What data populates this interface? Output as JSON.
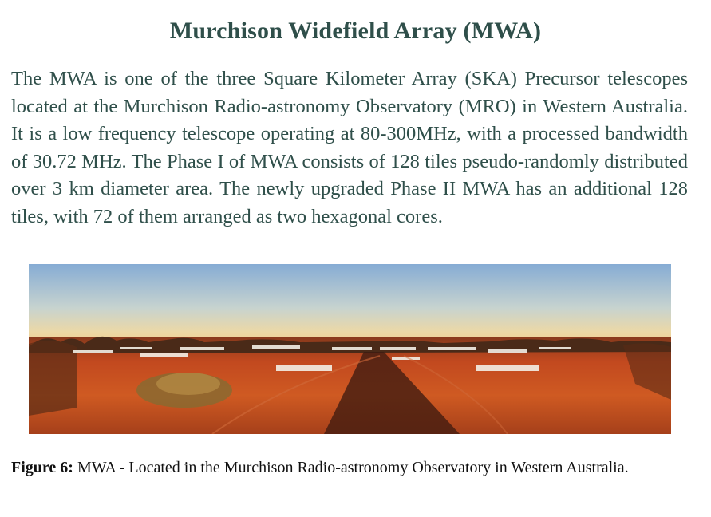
{
  "header": {
    "title": "Murchison Widefield Array (MWA)"
  },
  "main": {
    "paragraph": "The MWA is one of the three Square Kilometer Array (SKA) Precursor telescopes located at the Murchison Radio-astronomy Observatory (MRO) in Western Australia. It is a low frequency telescope operating at 80-300MHz, with a processed bandwidth of 30.72 MHz. The Phase I of MWA consists of 128 tiles pseudo-randomly distributed over 3 km diameter area. The newly upgraded Phase II MWA has an additional 128 tiles, with 72 of them arranged as two hexagonal cores."
  },
  "figure": {
    "caption_label": "Figure 6:",
    "caption_text": "MWA - Located in the Murchison Radio-astronomy Observatory in Western Australia."
  },
  "colors": {
    "title": "#2f4f4a",
    "sky_top": "#88aed6",
    "sky_horizon": "#f2d9a0",
    "ground": "#b8401e"
  }
}
